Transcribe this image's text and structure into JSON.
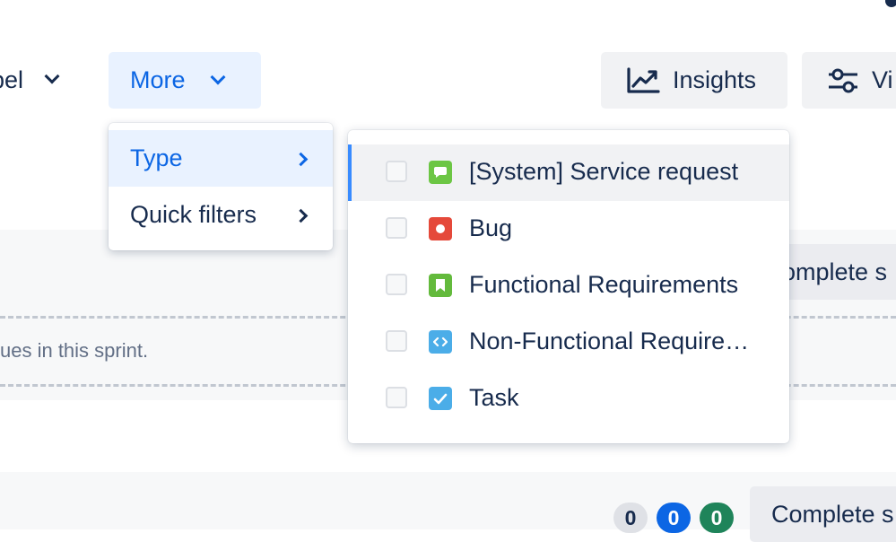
{
  "toolbar": {
    "label_filter": "bel",
    "more_label": "More",
    "insights_label": "Insights",
    "view_label": "Vi"
  },
  "more_menu": {
    "items": [
      {
        "label": "Type"
      },
      {
        "label": "Quick filters"
      }
    ]
  },
  "type_menu": {
    "items": [
      {
        "label": "[System] Service request",
        "icon": "speech-bubble-icon",
        "color": "#6cc644"
      },
      {
        "label": "Bug",
        "icon": "bug-icon",
        "color": "#e5493a"
      },
      {
        "label": "Functional Requirements",
        "icon": "bookmark-icon",
        "color": "#63ba3c"
      },
      {
        "label": "Non-Functional Require…",
        "icon": "code-icon",
        "color": "#4bade8"
      },
      {
        "label": "Task",
        "icon": "checkmark-icon",
        "color": "#4bade8"
      }
    ]
  },
  "sprint": {
    "complete_label": "omplete s",
    "empty_message": "ues in this sprint."
  },
  "next_sprint": {
    "badge_todo": "0",
    "badge_in_progress": "0",
    "badge_done": "0",
    "complete_label": "Complete s"
  }
}
